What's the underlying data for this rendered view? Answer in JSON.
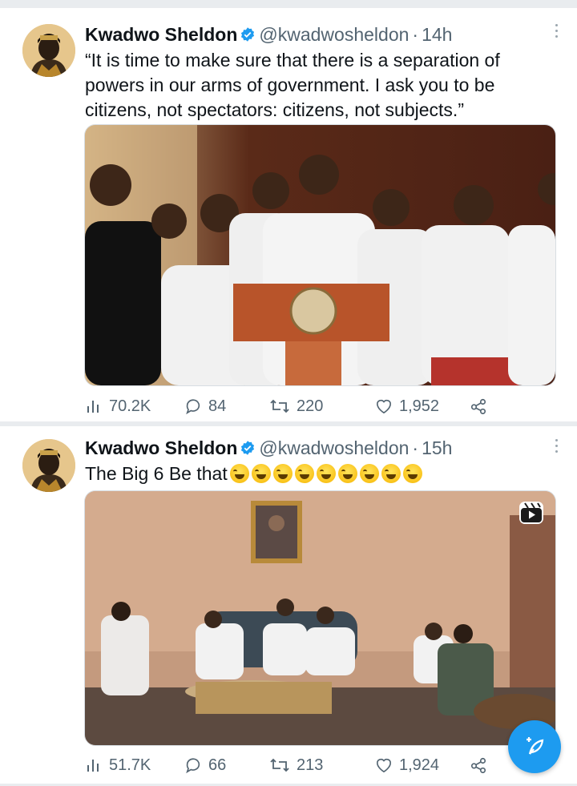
{
  "tweets": [
    {
      "author": "Kwadwo Sheldon",
      "handle": "@kwadwosheldon",
      "separator": "·",
      "time": "14h",
      "text": "“It is time to make sure that there is a separation of\npowers in our arms of government. I ask you to be\ncitizens, not spectators: citizens, not subjects.”",
      "stats": {
        "views": "70.2K",
        "replies": "84",
        "retweets": "220",
        "likes": "1,952"
      }
    },
    {
      "author": "Kwadwo Sheldon",
      "handle": "@kwadwosheldon",
      "separator": "·",
      "time": "15h",
      "text": "The Big 6 Be that",
      "emoji_count": 9,
      "stats": {
        "views": "51.7K",
        "replies": "66",
        "retweets": "213",
        "likes": "1,924"
      }
    }
  ],
  "colors": {
    "accent": "#1d9bf0",
    "muted": "#536471",
    "text": "#0f1419",
    "background": "#e9ecef"
  },
  "icons": [
    "verified-badge-icon",
    "more-icon",
    "views-icon",
    "reply-icon",
    "retweet-icon",
    "like-icon",
    "share-icon",
    "reel-icon",
    "compose-icon"
  ]
}
